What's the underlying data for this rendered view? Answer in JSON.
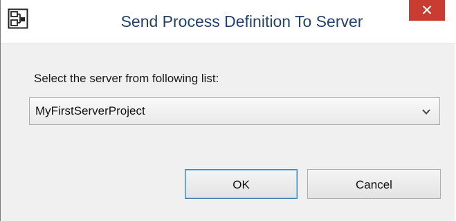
{
  "window": {
    "title": "Send Process Definition To Server",
    "icon": "process-diagram-icon",
    "close_glyph": "✕",
    "accent_close_color": "#c83c32",
    "title_color": "#24416b"
  },
  "form": {
    "prompt": "Select the server from following list:",
    "server_select": {
      "selected": "MyFirstServerProject"
    }
  },
  "buttons": {
    "ok_label": "OK",
    "cancel_label": "Cancel"
  }
}
